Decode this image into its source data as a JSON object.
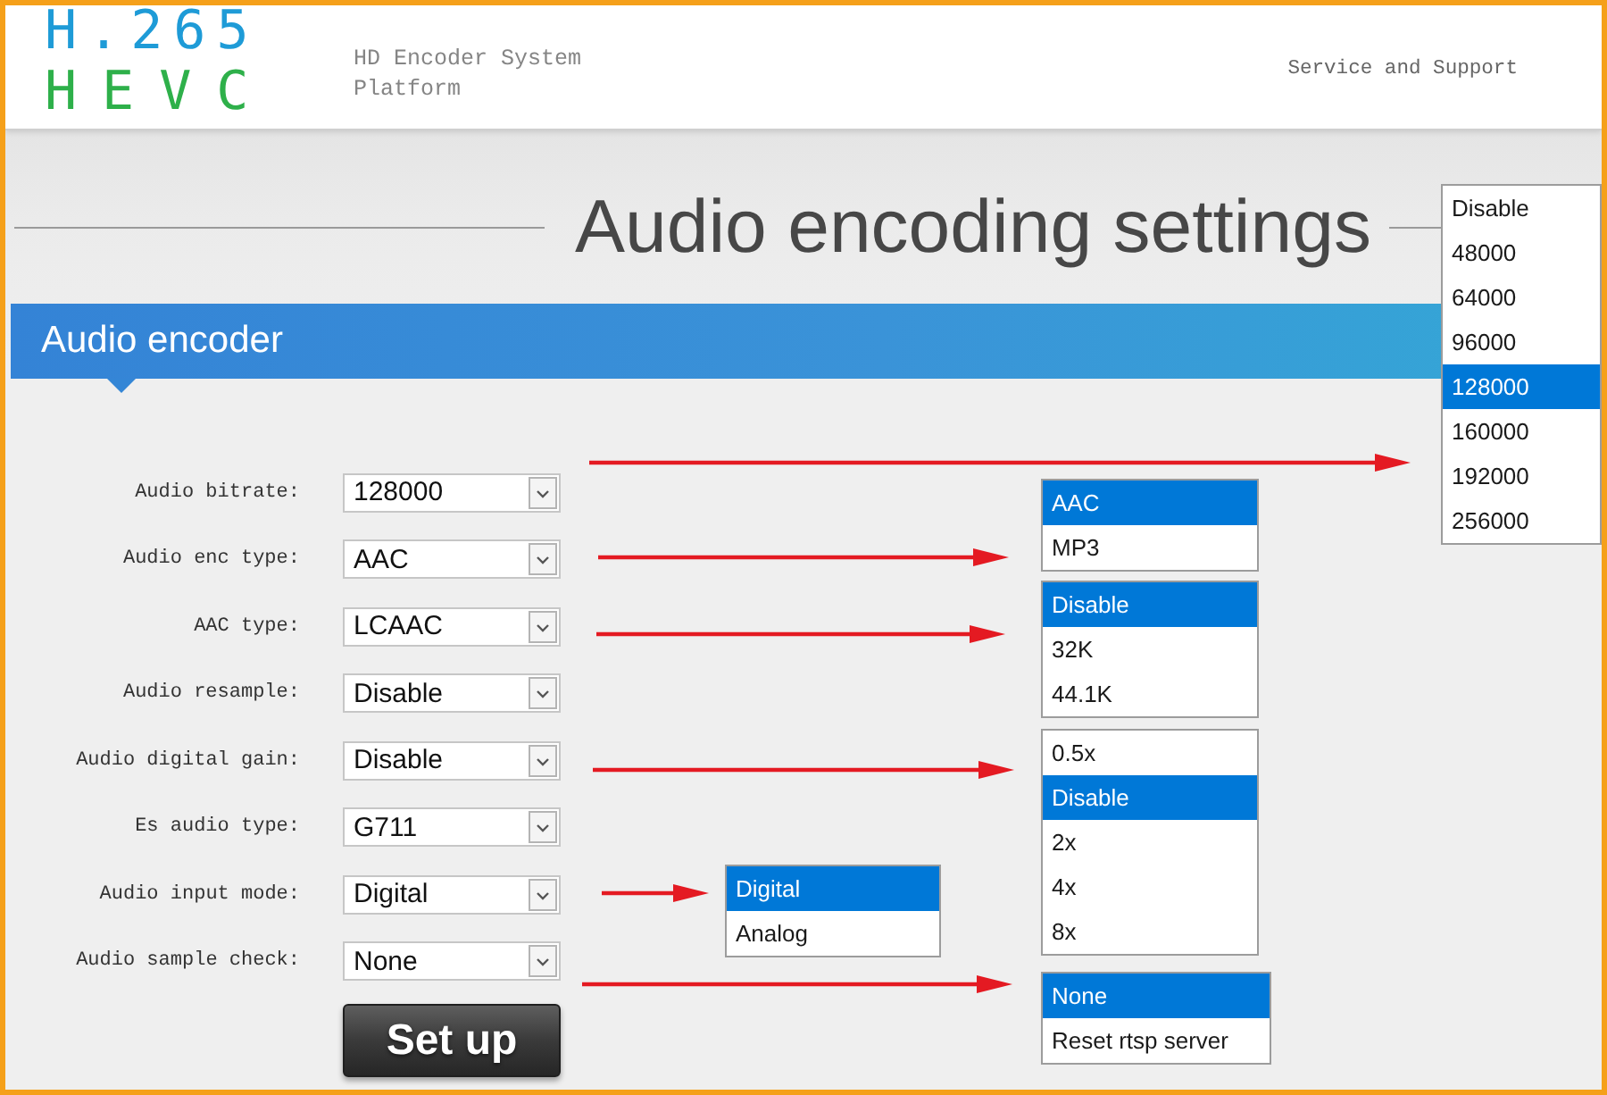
{
  "header": {
    "logo_line_1": "H.265",
    "logo_line_2": "HEVC",
    "platform_title": "HD Encoder System Platform",
    "support_link": "Service and Support"
  },
  "page_title": "Audio encoding settings",
  "section": {
    "title": "Audio encoder"
  },
  "fields": [
    {
      "label": "Audio bitrate:",
      "value": "128000",
      "options": [
        {
          "label": "Disable",
          "selected": false
        },
        {
          "label": "48000",
          "selected": false
        },
        {
          "label": "64000",
          "selected": false
        },
        {
          "label": "96000",
          "selected": false
        },
        {
          "label": "128000",
          "selected": true
        },
        {
          "label": "160000",
          "selected": false
        },
        {
          "label": "192000",
          "selected": false
        },
        {
          "label": "256000",
          "selected": false
        }
      ]
    },
    {
      "label": "Audio enc type:",
      "value": "AAC",
      "options": [
        {
          "label": "AAC",
          "selected": true
        },
        {
          "label": "MP3",
          "selected": false
        }
      ]
    },
    {
      "label": "AAC type:",
      "value": "LCAAC",
      "options": [
        {
          "label": "Disable",
          "selected": true
        },
        {
          "label": "32K",
          "selected": false
        },
        {
          "label": "44.1K",
          "selected": false
        }
      ]
    },
    {
      "label": "Audio resample:",
      "value": "Disable"
    },
    {
      "label": "Audio digital gain:",
      "value": "Disable",
      "options": [
        {
          "label": "0.5x",
          "selected": false
        },
        {
          "label": "Disable",
          "selected": true
        },
        {
          "label": "2x",
          "selected": false
        },
        {
          "label": "4x",
          "selected": false
        },
        {
          "label": "8x",
          "selected": false
        }
      ]
    },
    {
      "label": "Es audio type:",
      "value": "G711"
    },
    {
      "label": "Audio input mode:",
      "value": "Digital",
      "options": [
        {
          "label": "Digital",
          "selected": true
        },
        {
          "label": "Analog",
          "selected": false
        }
      ]
    },
    {
      "label": "Audio sample check:",
      "value": "None",
      "options": [
        {
          "label": "None",
          "selected": true
        },
        {
          "label": "Reset rtsp server",
          "selected": false
        }
      ]
    }
  ],
  "setup_button": "Set up"
}
